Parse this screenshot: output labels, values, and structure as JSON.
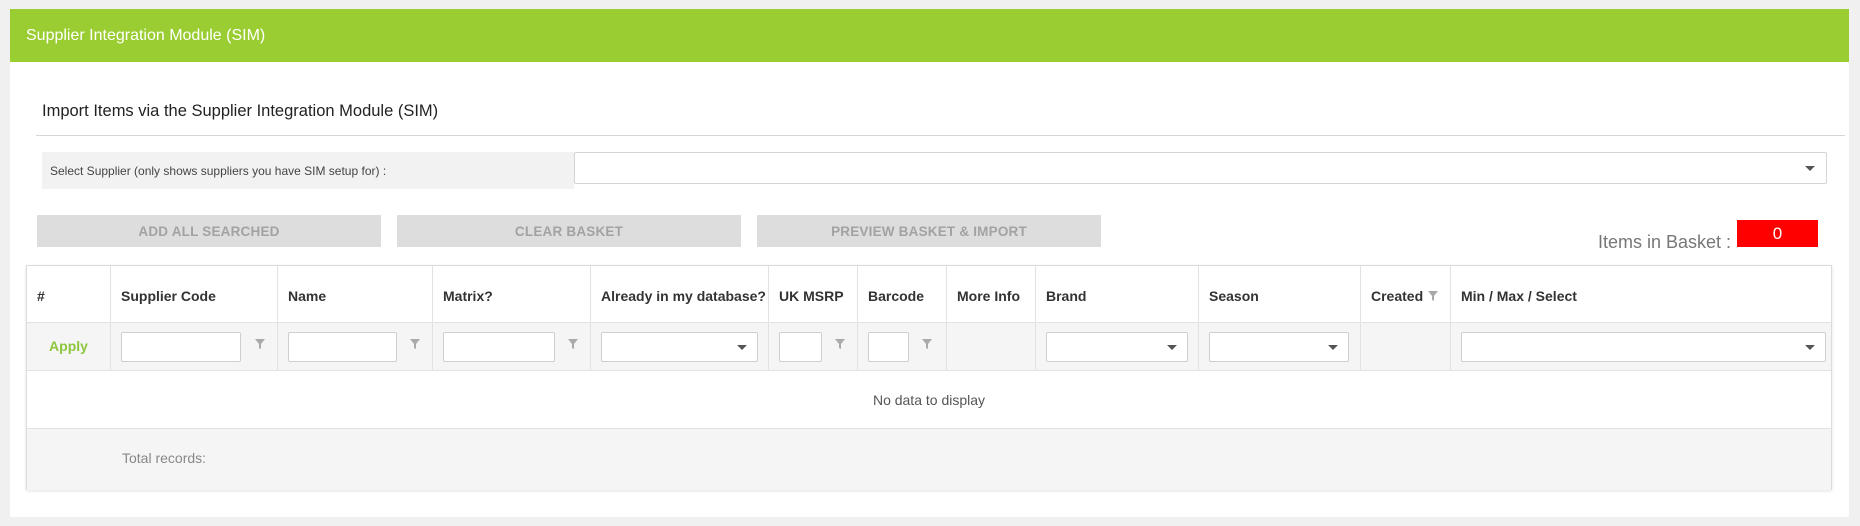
{
  "panel": {
    "title": "Supplier Integration Module (SIM)"
  },
  "section": {
    "title": "Import Items via the Supplier Integration Module (SIM)"
  },
  "supplier": {
    "label": "Select Supplier (only shows suppliers you have SIM setup for) :",
    "value": ""
  },
  "buttons": {
    "add_all": "ADD ALL SEARCHED",
    "clear": "CLEAR BASKET",
    "preview": "PREVIEW BASKET & IMPORT"
  },
  "basket": {
    "label": "Items in Basket :",
    "count": "0",
    "count_color": "#ff0000"
  },
  "accent_color": "#9acd32",
  "grid": {
    "columns": [
      {
        "key": "index",
        "label": "#"
      },
      {
        "key": "supplier_code",
        "label": "Supplier Code"
      },
      {
        "key": "name",
        "label": "Name"
      },
      {
        "key": "matrix",
        "label": "Matrix?"
      },
      {
        "key": "in_db",
        "label": "Already in my database?"
      },
      {
        "key": "uk_msrp",
        "label": "UK MSRP"
      },
      {
        "key": "barcode",
        "label": "Barcode"
      },
      {
        "key": "more_info",
        "label": "More Info"
      },
      {
        "key": "brand",
        "label": "Brand"
      },
      {
        "key": "season",
        "label": "Season"
      },
      {
        "key": "created",
        "label": "Created"
      },
      {
        "key": "min_max",
        "label": "Min / Max / Select"
      }
    ],
    "apply_label": "Apply",
    "no_data": "No data to display",
    "footer": "Total records:"
  }
}
